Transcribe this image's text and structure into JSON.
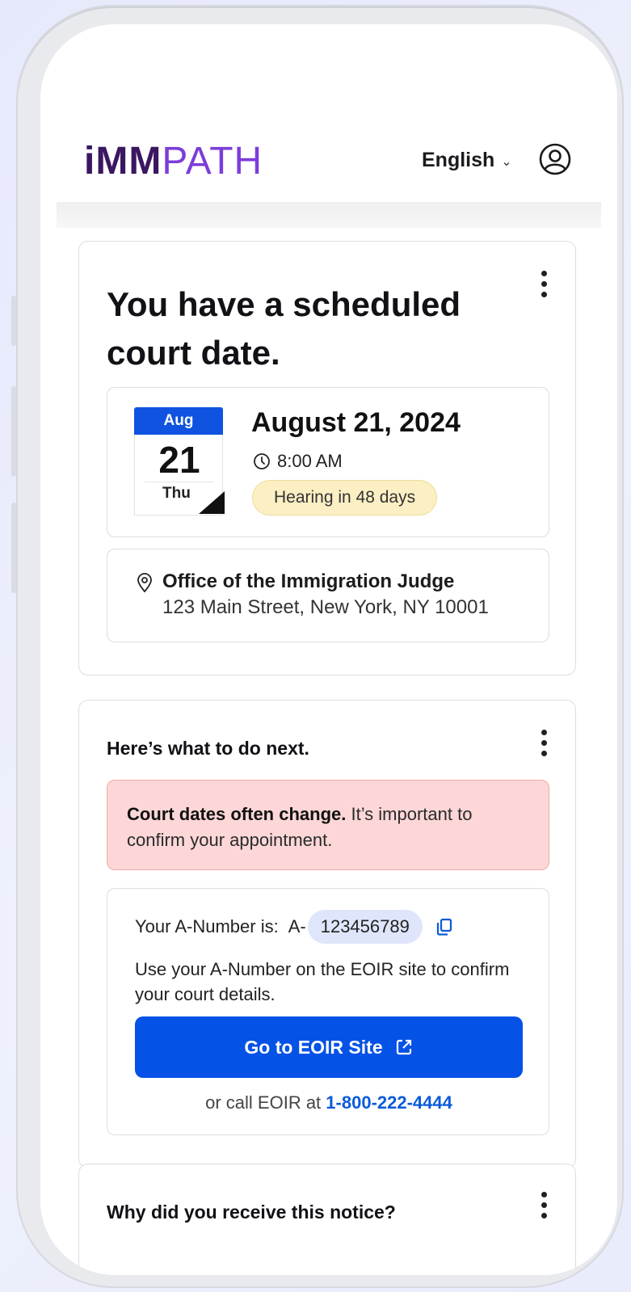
{
  "header": {
    "logo_bold": "iMM",
    "logo_light": "PATH",
    "language": "English"
  },
  "court_card": {
    "title": "You have a scheduled court date.",
    "calendar": {
      "month": "Aug",
      "day": "21",
      "weekday": "Thu"
    },
    "date": "August 21, 2024",
    "time": "8:00 AM",
    "badge": "Hearing in 48 days",
    "location_name": "Office of the Immigration Judge",
    "location_address": "123 Main Street, New York, NY 10001"
  },
  "next_card": {
    "title": "Here’s what to do next.",
    "alert_bold": "Court dates often change.",
    "alert_text": " It’s important to confirm your appointment.",
    "anumber_label": "Your A-Number is:",
    "anumber_prefix": "A-",
    "anumber_value": "123456789",
    "anumber_desc": "Use your A-Number on the EOIR site to confirm your court details.",
    "button_label": "Go to EOIR Site",
    "call_prefix": "or call EOIR at",
    "call_number": "1-800-222-4444"
  },
  "notice_card": {
    "title": "Why did you receive this notice?"
  },
  "colors": {
    "brand_dark": "#3a1760",
    "brand_light": "#7c3dd9",
    "primary": "#0552e6",
    "alert_bg": "#fdd7d7",
    "badge_bg": "#fbefc3"
  }
}
